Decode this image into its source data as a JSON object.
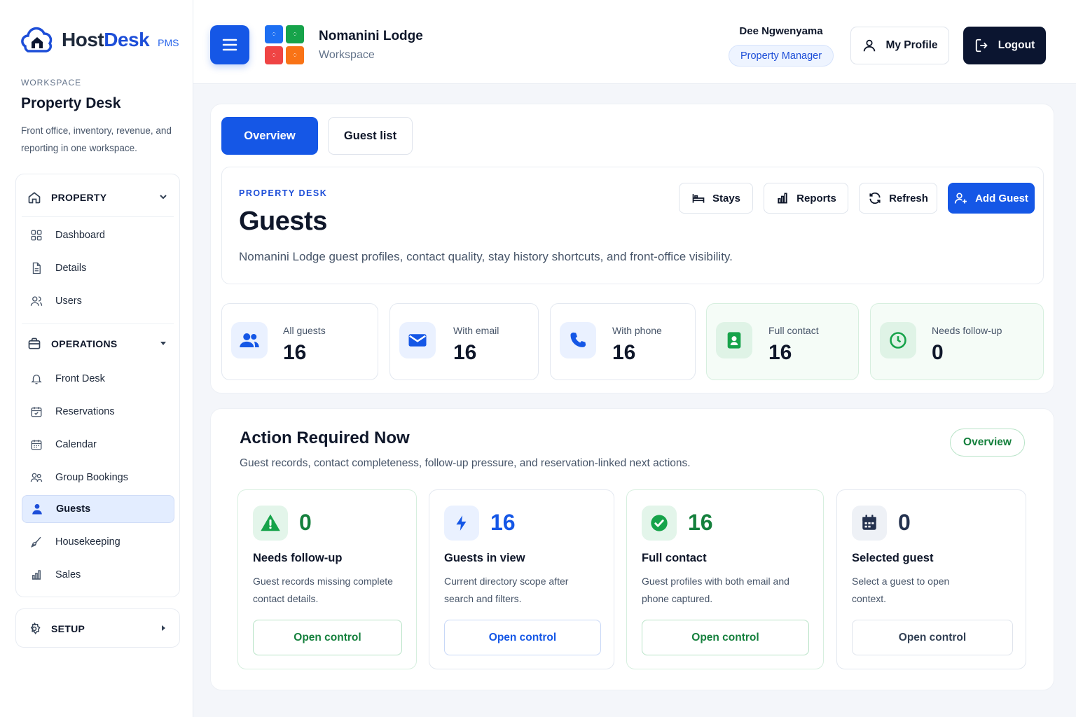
{
  "brand": {
    "name_a": "Host",
    "name_b": "Desk",
    "suffix": "PMS"
  },
  "workspace": {
    "kicker": "WORKSPACE",
    "title": "Property Desk",
    "description": "Front office, inventory, revenue, and reporting in one workspace."
  },
  "sidebar": {
    "property": {
      "label": "PROPERTY",
      "items": [
        {
          "label": "Dashboard",
          "icon": "grid-icon"
        },
        {
          "label": "Details",
          "icon": "document-icon"
        },
        {
          "label": "Users",
          "icon": "users-icon"
        }
      ]
    },
    "operations": {
      "label": "OPERATIONS",
      "items": [
        {
          "label": "Front Desk",
          "icon": "bell-icon"
        },
        {
          "label": "Reservations",
          "icon": "calendar-check-icon"
        },
        {
          "label": "Calendar",
          "icon": "calendar-icon"
        },
        {
          "label": "Group Bookings",
          "icon": "group-icon"
        },
        {
          "label": "Guests",
          "icon": "person-icon",
          "active": true
        },
        {
          "label": "Housekeeping",
          "icon": "broom-icon"
        },
        {
          "label": "Sales",
          "icon": "bar-chart-icon"
        }
      ]
    },
    "setup": {
      "label": "SETUP"
    }
  },
  "header": {
    "lodge_name": "Nomanini Lodge",
    "lodge_sub": "Workspace",
    "user_name": "Dee Ngwenyama",
    "user_role": "Property Manager",
    "profile_label": "My Profile",
    "logout_label": "Logout"
  },
  "tabs": [
    {
      "label": "Overview",
      "active": true
    },
    {
      "label": "Guest list",
      "active": false
    }
  ],
  "hero": {
    "kicker": "PROPERTY DESK",
    "title": "Guests",
    "description": "Nomanini Lodge guest profiles, contact quality, stay history shortcuts, and front-office visibility.",
    "buttons": {
      "stays": "Stays",
      "reports": "Reports",
      "refresh": "Refresh",
      "add_guest": "Add Guest"
    }
  },
  "stats": [
    {
      "label": "All guests",
      "value": "16",
      "icon": "users-icon"
    },
    {
      "label": "With email",
      "value": "16",
      "icon": "mail-icon"
    },
    {
      "label": "With phone",
      "value": "16",
      "icon": "phone-icon"
    },
    {
      "label": "Full contact",
      "value": "16",
      "icon": "contact-card-icon"
    },
    {
      "label": "Needs follow-up",
      "value": "0",
      "icon": "clock-icon"
    }
  ],
  "action": {
    "title": "Action Required Now",
    "description": "Guest records, contact completeness, follow-up pressure, and reservation-linked next actions.",
    "badge": "Overview",
    "cards": [
      {
        "value": "0",
        "title": "Needs follow-up",
        "description": "Guest records missing complete contact details.",
        "button": "Open control",
        "icon": "warning-icon"
      },
      {
        "value": "16",
        "title": "Guests in view",
        "description": "Current directory scope after search and filters.",
        "button": "Open control",
        "icon": "bolt-icon"
      },
      {
        "value": "16",
        "title": "Full contact",
        "description": "Guest profiles with both email and phone captured.",
        "button": "Open control",
        "icon": "check-circle-icon"
      },
      {
        "value": "0",
        "title": "Selected guest",
        "description": "Select a guest to open context.",
        "button": "Open control",
        "icon": "calendar-icon"
      }
    ]
  },
  "colors": {
    "primary": "#1557e6",
    "dark": "#0b1530",
    "green": "#15803d",
    "text": "#0f172a",
    "muted": "#475569"
  }
}
